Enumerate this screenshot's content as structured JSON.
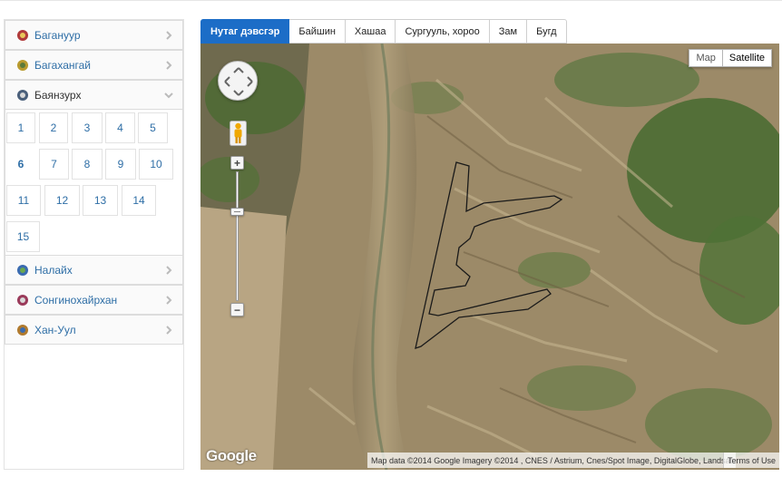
{
  "sidebar": {
    "items_top": [
      {
        "label": "Багануур",
        "color": "#b03a3a"
      },
      {
        "label": "Багахангай",
        "color": "#b89a2e"
      },
      {
        "label": "Баянзурх",
        "color": "#4a5f7a"
      }
    ],
    "numbers": [
      "1",
      "2",
      "3",
      "4",
      "5",
      "6",
      "7",
      "8",
      "9",
      "10",
      "11",
      "12",
      "13",
      "14",
      "15"
    ],
    "active_number": "6",
    "items_bottom": [
      {
        "label": "Налайх",
        "color": "#3a6bb0"
      },
      {
        "label": "Сонгинохайрхан",
        "color": "#9a3a5a"
      },
      {
        "label": "Хан-Уул",
        "color": "#b07a2e"
      }
    ]
  },
  "tabs": [
    "Нутаг дэвсгэр",
    "Байшин",
    "Хашаа",
    "Сургууль, хороо",
    "Зам",
    "Бугд"
  ],
  "active_tab": "Нутаг дэвсгэр",
  "map": {
    "type_buttons": [
      "Map",
      "Satellite"
    ],
    "active_type": "Satellite",
    "logo": "Google",
    "attribution": "Map data ©2014 Google Imagery ©2014 , CNES / Astrium, Cnes/Spot Image, DigitalGlobe, Landsat",
    "terms": "Terms of Use"
  },
  "colors": {
    "accent": "#1c6dc7",
    "link": "#2e6ea6"
  }
}
